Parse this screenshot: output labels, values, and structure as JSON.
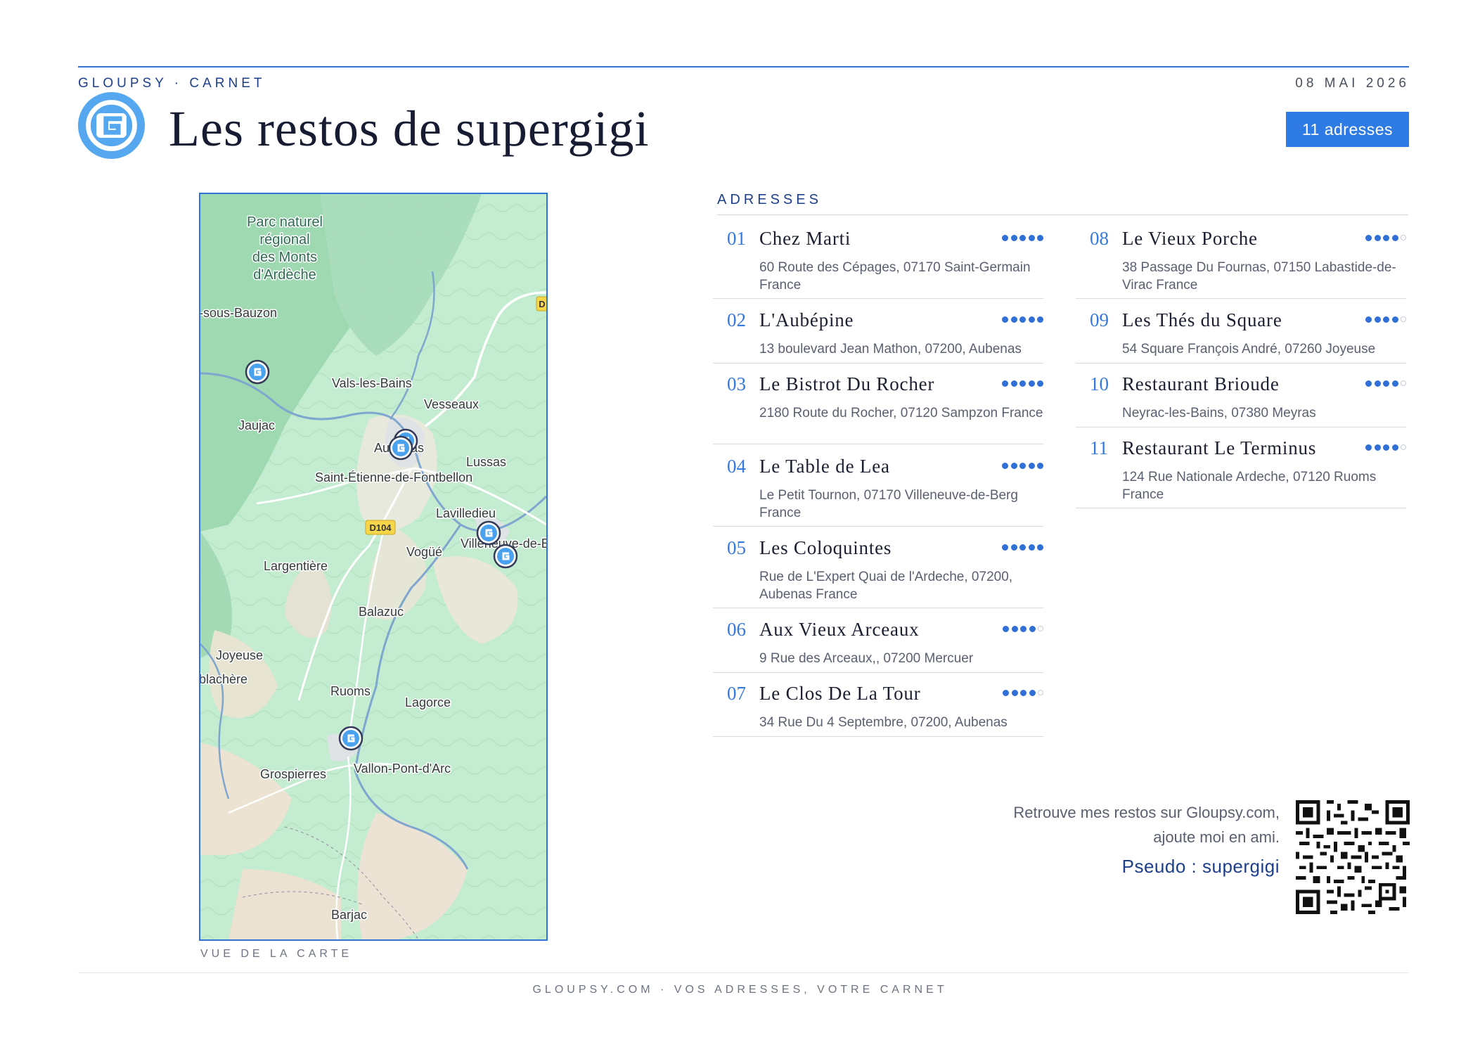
{
  "header": {
    "brand": "GLOUPSY · CARNET",
    "date": "08 MAI 2026",
    "title": "Les restos de supergigi",
    "count_badge": "11 adresses",
    "logo_icon": "gloupsy-g-logo-icon",
    "accent_color": "#2f7be6"
  },
  "map": {
    "caption": "VUE DE LA CARTE",
    "labels": {
      "park1": "Parc naturel",
      "park2": "régional",
      "park3": "des Monts",
      "park4": "d'Ardèche",
      "sous_bauzon": "-sous-Bauzon",
      "vals": "Vals-les-Bains",
      "vesseaux": "Vesseaux",
      "jaujac": "Jaujac",
      "aubenas": "Aubenas",
      "lussas": "Lussas",
      "saint_etienne": "Saint-Étienne-de-Fontbellon",
      "lavilledieu": "Lavilledieu",
      "villeneuve": "Villeneuve-de-B",
      "road_d104": "D104",
      "road_d": "D",
      "vogue": "Vogüé",
      "largentiere": "Largentière",
      "balazuc": "Balazuc",
      "joyeuse": "Joyeuse",
      "blachere": "blachère",
      "ruoms": "Ruoms",
      "lagorce": "Lagorce",
      "vallon": "Vallon-Pont-d'Arc",
      "grospierres": "Grospierres",
      "barjac": "Barjac"
    },
    "marker_icon": "gloupsy-pin-icon"
  },
  "addresses": {
    "section_title": "ADRESSES",
    "items": [
      {
        "num": "01",
        "name": "Chez Marti",
        "address": "60 Route des Cépages, 07170 Saint-Germain France",
        "rating": 5
      },
      {
        "num": "02",
        "name": "L'Aubépine",
        "address": "13 boulevard Jean Mathon, 07200, Aubenas",
        "rating": 5
      },
      {
        "num": "03",
        "name": "Le Bistrot Du Rocher",
        "address": "2180 Route du Rocher, 07120 Sampzon France",
        "rating": 5
      },
      {
        "num": "04",
        "name": "Le Table de Lea",
        "address": "Le Petit Tournon, 07170 Villeneuve-de-Berg France",
        "rating": 5
      },
      {
        "num": "05",
        "name": "Les Coloquintes",
        "address": "Rue de L'Expert Quai de l'Ardeche, 07200, Aubenas France",
        "rating": 5
      },
      {
        "num": "06",
        "name": "Aux Vieux Arceaux",
        "address": "9 Rue des Arceaux,, 07200 Mercuer",
        "rating": 4
      },
      {
        "num": "07",
        "name": "Le Clos De La Tour",
        "address": "34 Rue Du 4 Septembre, 07200, Aubenas",
        "rating": 4
      },
      {
        "num": "08",
        "name": "Le Vieux Porche",
        "address": "38 Passage Du Fournas, 07150 Labastide-de-Virac France",
        "rating": 4
      },
      {
        "num": "09",
        "name": "Les Thés du Square",
        "address": "54 Square François André, 07260 Joyeuse",
        "rating": 4
      },
      {
        "num": "10",
        "name": "Restaurant Brioude",
        "address": "Neyrac-les-Bains, 07380 Meyras",
        "rating": 4
      },
      {
        "num": "11",
        "name": "Restaurant Le Terminus",
        "address": "124 Rue Nationale Ardeche, 07120 Ruoms France",
        "rating": 4
      }
    ],
    "rating_max": 5
  },
  "promo": {
    "line1": "Retrouve mes restos sur Gloupsy.com,",
    "line2": "ajoute moi en ami.",
    "pseudo": "Pseudo : supergigi",
    "qr_icon": "qr-code-icon"
  },
  "footer": {
    "tagline": "GLOUPSY.COM · VOS ADRESSES, VOTRE CARNET"
  }
}
